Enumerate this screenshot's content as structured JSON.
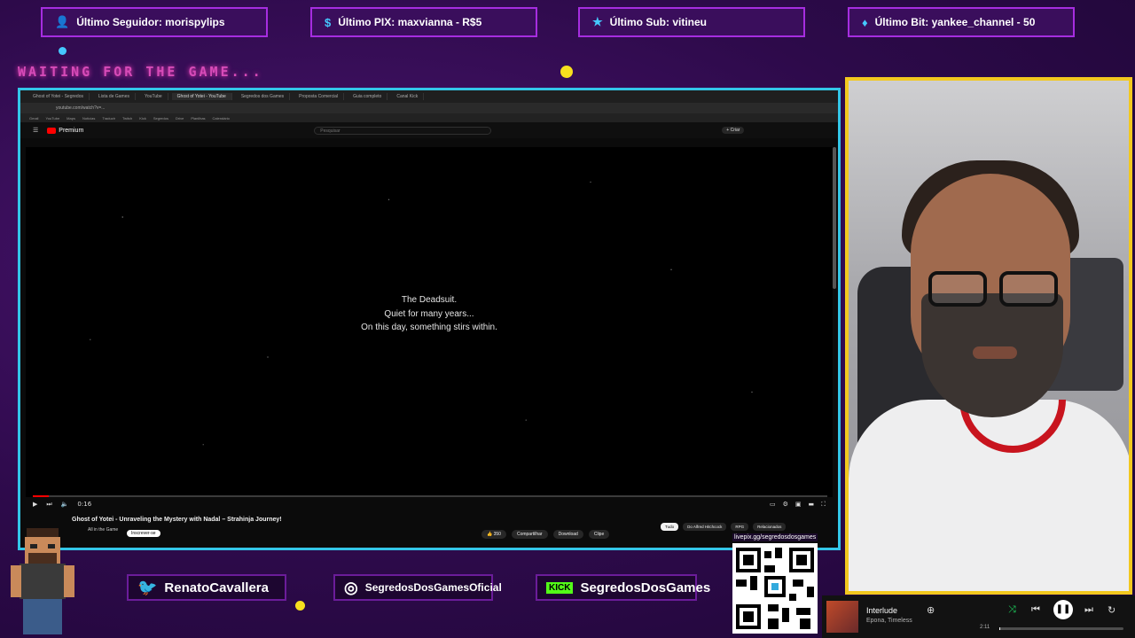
{
  "alerts": [
    {
      "icon": "person-icon",
      "text": "Último Seguidor: morispylips"
    },
    {
      "icon": "dollar-icon",
      "text": "Último PIX: maxvianna - R$5"
    },
    {
      "icon": "star-icon",
      "text": "Último Sub: vitineu"
    },
    {
      "icon": "diamond-icon",
      "text": "Último Bit: yankee_channel - 50"
    }
  ],
  "overlay": {
    "waiting_text": "WAITING FOR THE GAME..."
  },
  "browser": {
    "tabs": [
      "Ghost of Yotei - Segredos",
      "Lista de Games",
      "YouTube",
      "Ghost of Yotei - YouTube",
      "Segredos dos Games",
      "Proposta Comercial",
      "Guia completo",
      "Canal Kick"
    ],
    "active_tab": 3,
    "url": "youtube.com/watch?v=...",
    "bookmarks": [
      "Gmail",
      "YouTube",
      "Maps",
      "Notícias",
      "Traduzir",
      "Twitch",
      "Kick",
      "Segredos",
      "Drive",
      "Planilhas",
      "Calendário"
    ]
  },
  "youtube": {
    "logo": "Premium",
    "search_placeholder": "Pesquisar",
    "create_label": "+ Criar",
    "video_lines": [
      "The Deadsuit.",
      "Quiet for many years...",
      "On this day, something stirs within."
    ],
    "progress_fraction": 0.02,
    "time": "0:16",
    "title": "Ghost of Yotei - Unraveling the Mystery with Nadal – Strahinja Journey!",
    "channel": "All in the Game",
    "subscribe": "Inscrever-se",
    "likes": "350",
    "actions": [
      "Compartilhar",
      "Download",
      "Clipe"
    ],
    "chips": [
      "Tudo",
      "Do Alfred Hitchcock",
      "RPG",
      "Relacionados"
    ]
  },
  "socials": [
    {
      "icon": "twitter-icon",
      "glyph": "🐦",
      "handle": "RenatoCavallera"
    },
    {
      "icon": "instagram-icon",
      "glyph": "◎",
      "handle": "SegredosDosGamesOficial"
    },
    {
      "icon": "kick-icon",
      "glyph": "KICK",
      "handle": "SegredosDosGames"
    }
  ],
  "qr": {
    "link": "livepix.gg/segredosdosgames"
  },
  "spotify": {
    "song": "Interlude",
    "artist": "Epona, Timeless",
    "time": "2:11",
    "progress_fraction": 0.01
  },
  "colors": {
    "background": "#2d0a4a",
    "alert_border": "#a62de0",
    "browser_border": "#33c6e8",
    "webcam_border": "#f2c81e",
    "accent_pink": "#d64bb8",
    "youtube_red": "#ff0000",
    "kick_green": "#53fc18"
  }
}
